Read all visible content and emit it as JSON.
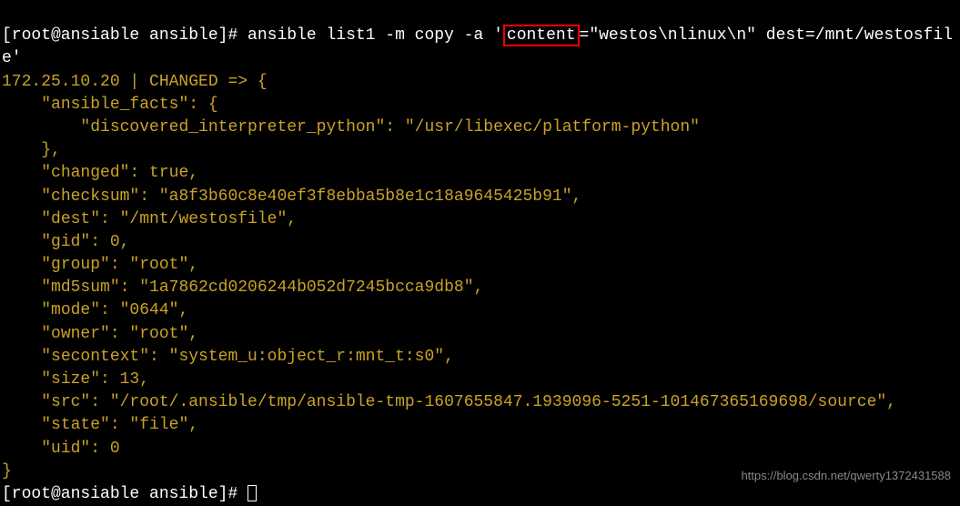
{
  "prompt1": {
    "user_host": "[root@ansiable ansible]# ",
    "cmd_part1": "ansible list1 -m copy -a '",
    "highlighted": "content",
    "cmd_part2": "=\"westos\\nlinux\\n\" dest=/mnt/westosfile'"
  },
  "output": {
    "host_status": "172.25.10.20 | CHANGED => {",
    "line_facts_open": "    \"ansible_facts\": {",
    "line_interpreter": "        \"discovered_interpreter_python\": \"/usr/libexec/platform-python\"",
    "line_facts_close": "    },",
    "line_changed_key": "    \"changed\": ",
    "line_changed_val": "true",
    "line_changed_comma": ",",
    "line_checksum": "    \"checksum\": \"a8f3b60c8e40ef3f8ebba5b8e1c18a9645425b91\",",
    "line_dest": "    \"dest\": \"/mnt/westosfile\",",
    "line_gid": "    \"gid\": 0,",
    "line_group": "    \"group\": \"root\",",
    "line_md5sum": "    \"md5sum\": \"1a7862cd0206244b052d7245bcca9db8\",",
    "line_mode": "    \"mode\": \"0644\",",
    "line_owner": "    \"owner\": \"root\",",
    "line_secontext": "    \"secontext\": \"system_u:object_r:mnt_t:s0\",",
    "line_size": "    \"size\": 13,",
    "line_src": "    \"src\": \"/root/.ansible/tmp/ansible-tmp-1607655847.1939096-5251-101467365169698/source\",",
    "line_state": "    \"state\": \"file\",",
    "line_uid": "    \"uid\": 0",
    "line_close": "}"
  },
  "prompt2": {
    "user_host": "[root@ansiable ansible]# "
  },
  "watermark": "https://blog.csdn.net/qwerty1372431588"
}
